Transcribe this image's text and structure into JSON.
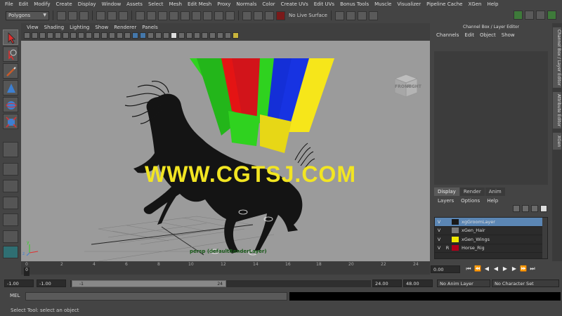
{
  "menu": [
    "File",
    "Edit",
    "Modify",
    "Create",
    "Display",
    "Window",
    "Assets",
    "Select",
    "Mesh",
    "Edit Mesh",
    "Proxy",
    "Normals",
    "Color",
    "Create UVs",
    "Edit UVs",
    "Bonus Tools",
    "Muscle",
    "Visualizer",
    "Pipeline Cache",
    "XGen",
    "Help"
  ],
  "statusline": {
    "mode": "Polygons",
    "live_surface": "No Live Surface"
  },
  "viewport": {
    "menu": [
      "View",
      "Shading",
      "Lighting",
      "Show",
      "Renderer",
      "Panels"
    ],
    "camera_label": "persp (defaultRenderLayer)",
    "viewcube_front": "FRONT",
    "viewcube_right": "RIGHT",
    "watermark": "WWW.CGTSJ.COM",
    "axis_y": "y",
    "axis_z": "z"
  },
  "channel_box": {
    "title": "Channel Box / Layer Editor",
    "menu": [
      "Channels",
      "Edit",
      "Object",
      "Show"
    ]
  },
  "layer_editor": {
    "tabs": [
      {
        "label": "Display",
        "active": true
      },
      {
        "label": "Render",
        "active": false
      },
      {
        "label": "Anim",
        "active": false
      }
    ],
    "menu": [
      "Layers",
      "Options",
      "Help"
    ],
    "layers": [
      {
        "v": "V",
        "r": "",
        "name": "xgGroomLayer",
        "color": "#1a1a1a",
        "selected": true
      },
      {
        "v": "V",
        "r": "",
        "name": "xGen_Hair",
        "color": "#7a7a7a",
        "selected": false
      },
      {
        "v": "V",
        "r": "",
        "name": "xGen_Wings",
        "color": "#f0e800",
        "selected": false
      },
      {
        "v": "V",
        "r": "R",
        "name": "Horse_Rig",
        "color": "#b0001a",
        "selected": false
      }
    ]
  },
  "side_tabs": [
    "Channel Box / Layer Editor",
    "Attribute Editor",
    "XGen"
  ],
  "timeline": {
    "ticks": [
      "0",
      "2",
      "4",
      "6",
      "8",
      "10",
      "12",
      "14",
      "16",
      "18",
      "20",
      "22",
      "24"
    ],
    "current_frame": "0",
    "time_field": "0.00"
  },
  "range": {
    "start_time": "-1.00",
    "start_range": "-1.00",
    "handle_start": "-1",
    "handle_end": "24",
    "end_range": "24.00",
    "end_time": "48.00",
    "anim_layer": "No Anim Layer",
    "character_set": "No Character Set"
  },
  "command_line": {
    "label": "MEL"
  },
  "help_line": "Select Tool: select an object",
  "colors": {
    "watermark": "#f2e522",
    "viewport_bg": "#9b9b9b",
    "ui_bg": "#444444",
    "selected_layer": "#5b86b4"
  }
}
